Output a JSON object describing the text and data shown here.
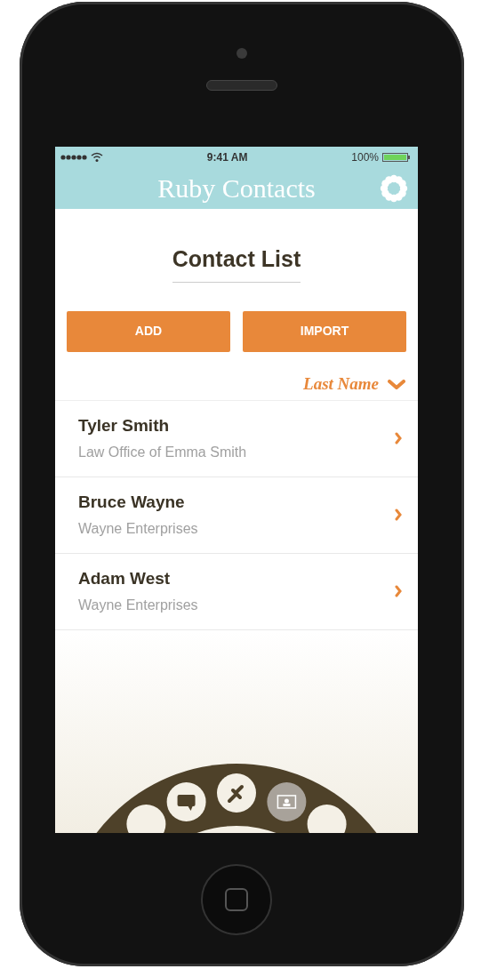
{
  "status_bar": {
    "time": "9:41 AM",
    "battery": "100%"
  },
  "header": {
    "title": "Ruby Contacts"
  },
  "page_title": "Contact List",
  "buttons": [
    "ADD",
    "IMPORT"
  ],
  "sort": {
    "label": "Last Name"
  },
  "contacts": [
    {
      "name": "Tyler Smith",
      "company": "Law Office of Emma Smith"
    },
    {
      "name": "Bruce Wayne",
      "company": "Wayne Enterprises"
    },
    {
      "name": "Adam West",
      "company": "Wayne Enterprises"
    }
  ],
  "dial": {
    "items": [
      {
        "kind": "blank",
        "selected": false
      },
      {
        "kind": "message",
        "selected": false
      },
      {
        "kind": "pin",
        "selected": false
      },
      {
        "kind": "card",
        "selected": true
      },
      {
        "kind": "blank",
        "selected": false
      }
    ]
  }
}
